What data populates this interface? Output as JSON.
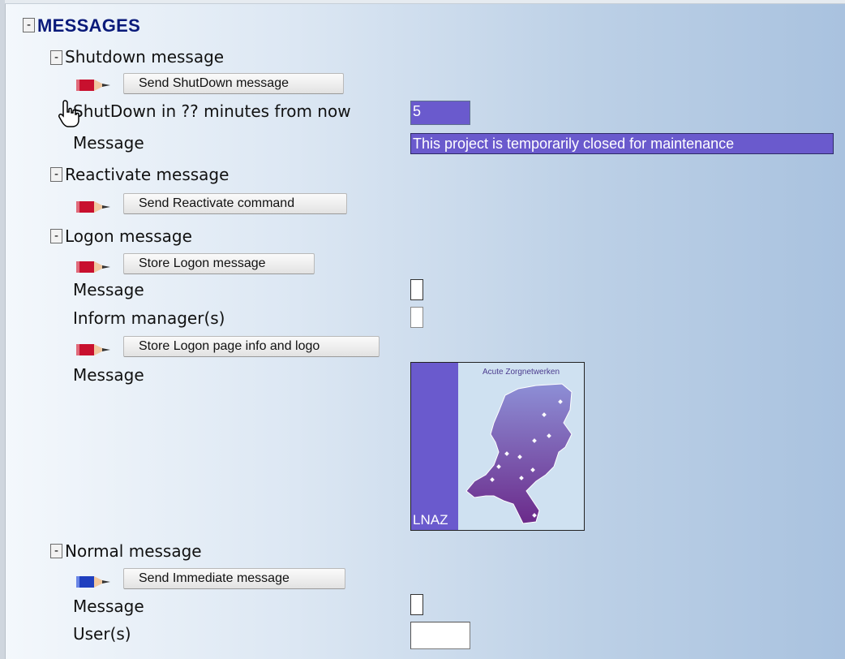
{
  "messages": {
    "title": "MESSAGES",
    "toggle_symbol": "-"
  },
  "shutdown": {
    "title": "Shutdown message",
    "button_label": "Send ShutDown message",
    "minutes_label": "ShutDown in ?? minutes from now",
    "minutes_value": "5",
    "message_label": "Message",
    "message_value": "This project is temporarily closed for maintenance"
  },
  "reactivate": {
    "title": "Reactivate message",
    "button_label": "Send Reactivate command"
  },
  "logon": {
    "title": "Logon message",
    "store_button_label": "Store Logon message",
    "message_label": "Message",
    "inform_label": "Inform manager(s)",
    "page_info_button_label": "Store Logon page info and logo",
    "logo_message_label": "Message",
    "logo_caption": "Acute Zorgnetwerken",
    "logo_text": "LNAZ"
  },
  "normal": {
    "title": "Normal message",
    "button_label": "Send Immediate message",
    "message_label": "Message",
    "users_label": "User(s)"
  },
  "icons": {
    "pencil_red": "pencil-red-icon",
    "pencil_blue": "pencil-blue-icon",
    "cursor": "hand-pointer-icon"
  },
  "colors": {
    "title_blue": "#0a1a7a",
    "input_purple": "#6a5acd",
    "pencil_red": "#c8102e",
    "pencil_blue": "#1f3fbf"
  }
}
